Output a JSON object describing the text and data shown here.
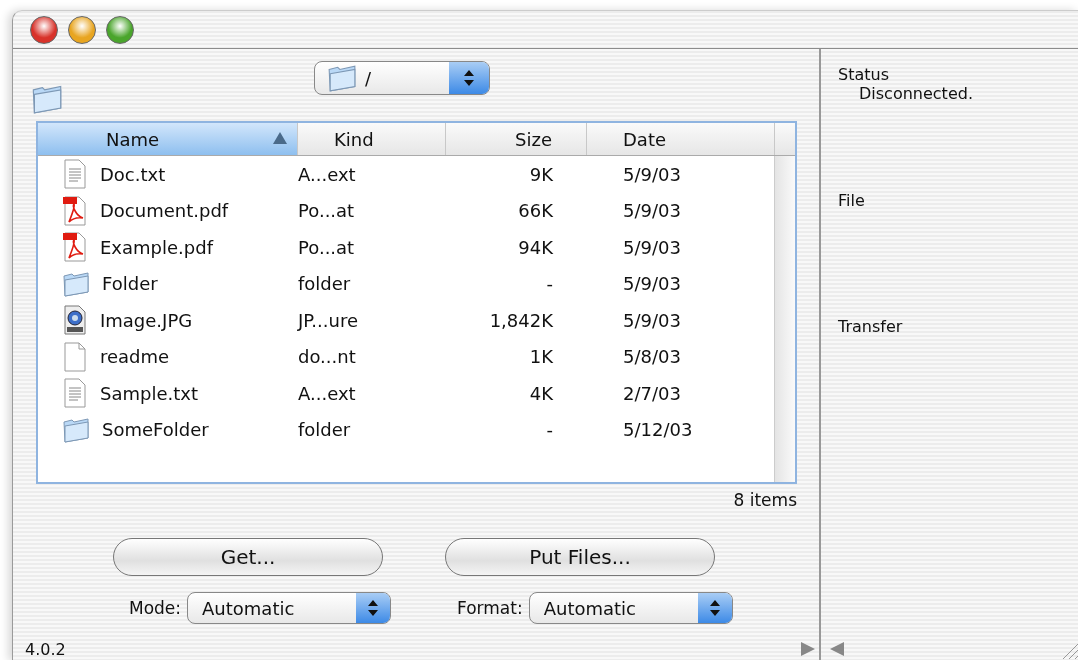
{
  "path_popup": {
    "value": "/"
  },
  "table": {
    "columns": [
      {
        "label": "Name",
        "selected": true
      },
      {
        "label": "Kind",
        "selected": false
      },
      {
        "label": "Size",
        "selected": false
      },
      {
        "label": "Date",
        "selected": false
      }
    ],
    "rows": [
      {
        "kind": "text",
        "name": "Doc.txt",
        "file_kind": "A...ext",
        "size": "9K",
        "date": "5/9/03"
      },
      {
        "kind": "pdf",
        "name": "Document.pdf",
        "file_kind": "Po...at",
        "size": "66K",
        "date": "5/9/03"
      },
      {
        "kind": "pdf",
        "name": "Example.pdf",
        "file_kind": "Po...at",
        "size": "94K",
        "date": "5/9/03"
      },
      {
        "kind": "folder",
        "name": "Folder",
        "file_kind": "folder",
        "size": "-",
        "date": "5/9/03"
      },
      {
        "kind": "image",
        "name": "Image.JPG",
        "file_kind": "JP...ure",
        "size": "1,842K",
        "date": "5/9/03"
      },
      {
        "kind": "blank",
        "name": "readme",
        "file_kind": "do...nt",
        "size": "1K",
        "date": "5/8/03"
      },
      {
        "kind": "text",
        "name": "Sample.txt",
        "file_kind": "A...ext",
        "size": "4K",
        "date": "2/7/03"
      },
      {
        "kind": "folder",
        "name": "SomeFolder",
        "file_kind": "folder",
        "size": "-",
        "date": "5/12/03"
      }
    ]
  },
  "item_count": "8 items",
  "buttons": [
    "Get...",
    "Put Files..."
  ],
  "popups": [
    {
      "label": "Mode:",
      "value": "Automatic"
    },
    {
      "label": "Format:",
      "value": "Automatic"
    }
  ],
  "version": "4.0.2",
  "side_panel": {
    "sections": [
      {
        "title": "Status",
        "value": "Disconnected."
      },
      {
        "title": "File"
      },
      {
        "title": "Transfer"
      }
    ]
  }
}
